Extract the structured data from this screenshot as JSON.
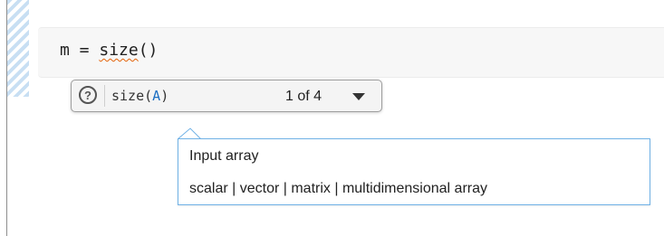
{
  "editor": {
    "code_prefix": "m = ",
    "code_function": "size",
    "code_suffix": "()"
  },
  "signature_tooltip": {
    "help_glyph": "?",
    "signature_prefix": "size(",
    "signature_arg": "A",
    "signature_suffix": ")",
    "overload_counter": "1 of 4",
    "help_icon": "help-circle-icon",
    "dropdown_icon": "caret-down-icon"
  },
  "argument_tooltip": {
    "description": "Input array",
    "options": "scalar | vector | matrix | multidimensional array"
  },
  "colors": {
    "argument_highlight": "#1b6ec2",
    "tooltip_border": "#6fb1e6",
    "spelling_squiggle": "#e36209"
  }
}
